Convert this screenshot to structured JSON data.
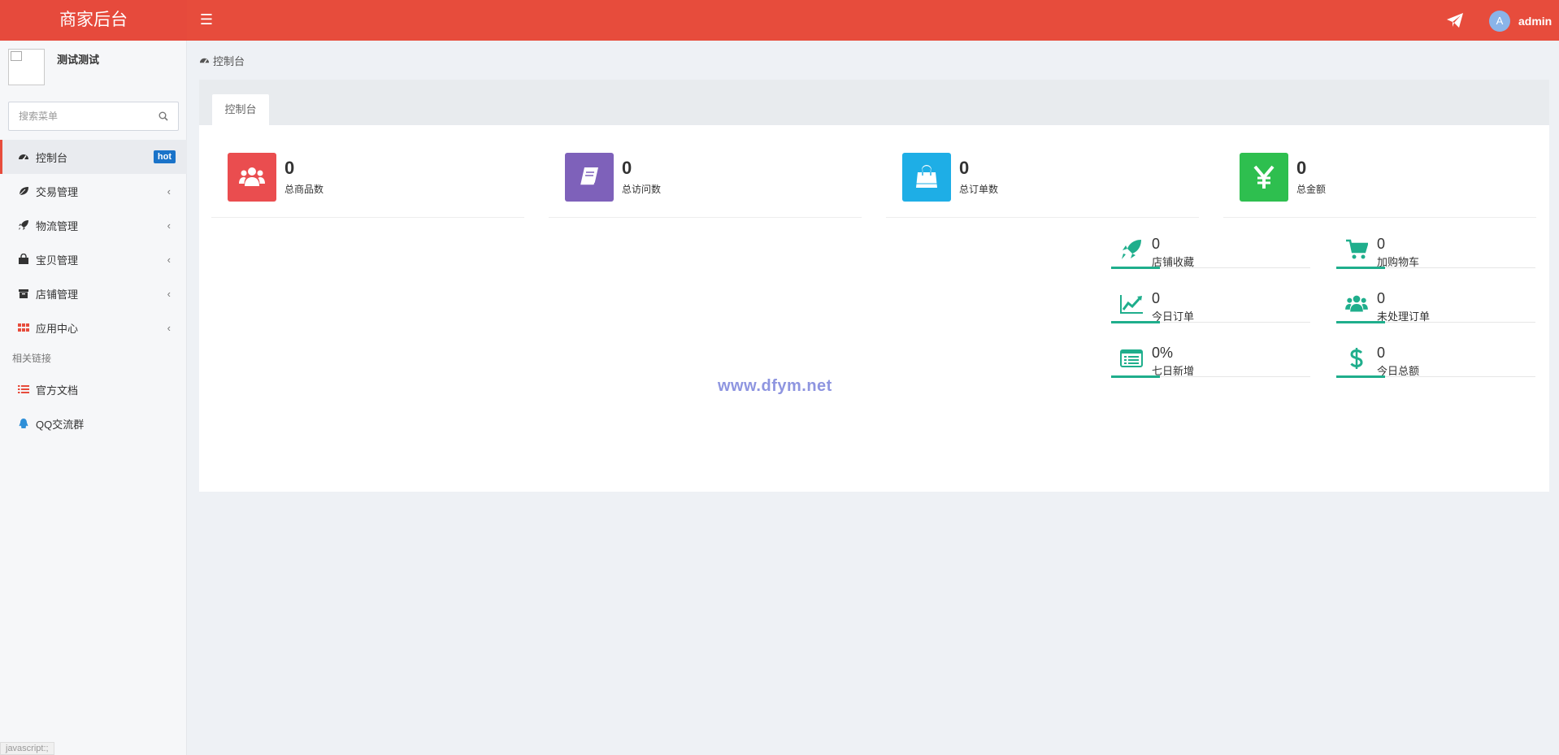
{
  "header": {
    "logo": "商家后台",
    "user_avatar_letter": "A",
    "user_name": "admin",
    "bg_color": "#e74c3c"
  },
  "sidebar": {
    "profile_name": "测试测试",
    "search_placeholder": "搜索菜单",
    "items": [
      {
        "label": "控制台",
        "icon": "dashboard-icon",
        "badge": "hot"
      },
      {
        "label": "交易管理",
        "icon": "leaf-icon"
      },
      {
        "label": "物流管理",
        "icon": "rocket-icon"
      },
      {
        "label": "宝贝管理",
        "icon": "bag-icon"
      },
      {
        "label": "店铺管理",
        "icon": "archive-icon"
      },
      {
        "label": "应用中心",
        "icon": "grid-icon"
      }
    ],
    "links_header": "相关链接",
    "links": [
      {
        "label": "官方文档",
        "icon": "list-icon"
      },
      {
        "label": "QQ交流群",
        "icon": "qq-icon"
      }
    ]
  },
  "breadcrumb": "控制台",
  "tab": "控制台",
  "stats": [
    {
      "value": "0",
      "label": "总商品数",
      "color": "#ea4d4f",
      "icon": "users-icon"
    },
    {
      "value": "0",
      "label": "总访问数",
      "color": "#7e61ba",
      "icon": "book-icon"
    },
    {
      "value": "0",
      "label": "总订单数",
      "color": "#1eaee6",
      "icon": "shopping-bag-icon"
    },
    {
      "value": "0",
      "label": "总金额",
      "color": "#2ebf4f",
      "icon": "yen-icon"
    }
  ],
  "mini_stats": [
    {
      "value": "0",
      "label": "店铺收藏",
      "icon": "rocket-icon"
    },
    {
      "value": "0",
      "label": "加购物车",
      "icon": "cart-icon"
    },
    {
      "value": "0",
      "label": "今日订单",
      "icon": "chart-line-icon"
    },
    {
      "value": "0",
      "label": "未处理订单",
      "icon": "users-icon"
    },
    {
      "value": "0%",
      "label": "七日新增",
      "icon": "list-alt-icon"
    },
    {
      "value": "0",
      "label": "今日总额",
      "icon": "dollar-icon"
    }
  ],
  "accent_color": "#1fae8c",
  "watermark": "www.dfym.net",
  "status_bar": "javascript:;"
}
